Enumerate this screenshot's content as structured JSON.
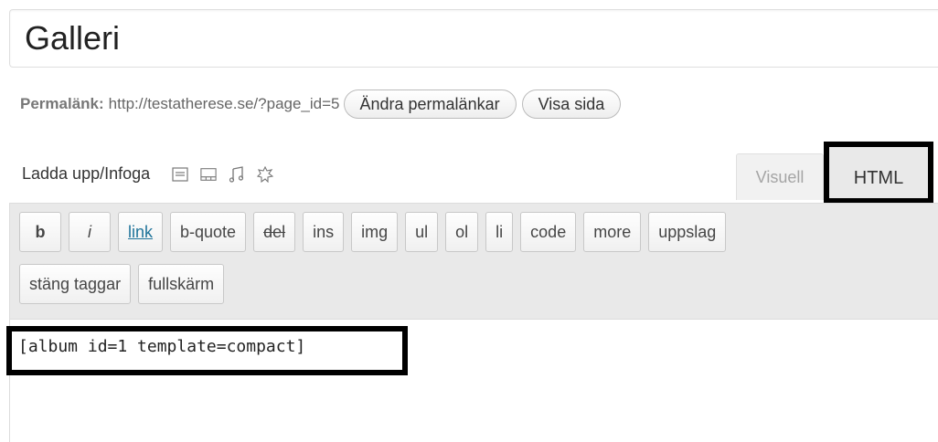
{
  "title": {
    "value": "Galleri"
  },
  "permalink": {
    "label": "Permalänk:",
    "url": "http://testatherese.se/?page_id=5",
    "change_button": "Ändra permalänkar",
    "view_button": "Visa sida"
  },
  "media": {
    "label": "Ladda upp/Infoga",
    "icons": [
      "image-icon",
      "video-icon",
      "audio-icon",
      "media-icon"
    ]
  },
  "tabs": {
    "visual": "Visuell",
    "html": "HTML"
  },
  "quicktags": {
    "row1": [
      "b",
      "i",
      "link",
      "b-quote",
      "del",
      "ins",
      "img",
      "ul",
      "ol",
      "li",
      "code",
      "more",
      "uppslag"
    ],
    "row2": [
      "stäng taggar",
      "fullskärm"
    ]
  },
  "editor": {
    "content": "[album id=1 template=compact]"
  },
  "colors": {
    "link": "#21759b",
    "highlight_border": "#000000",
    "toolbar_bg": "#e9e9e9"
  }
}
